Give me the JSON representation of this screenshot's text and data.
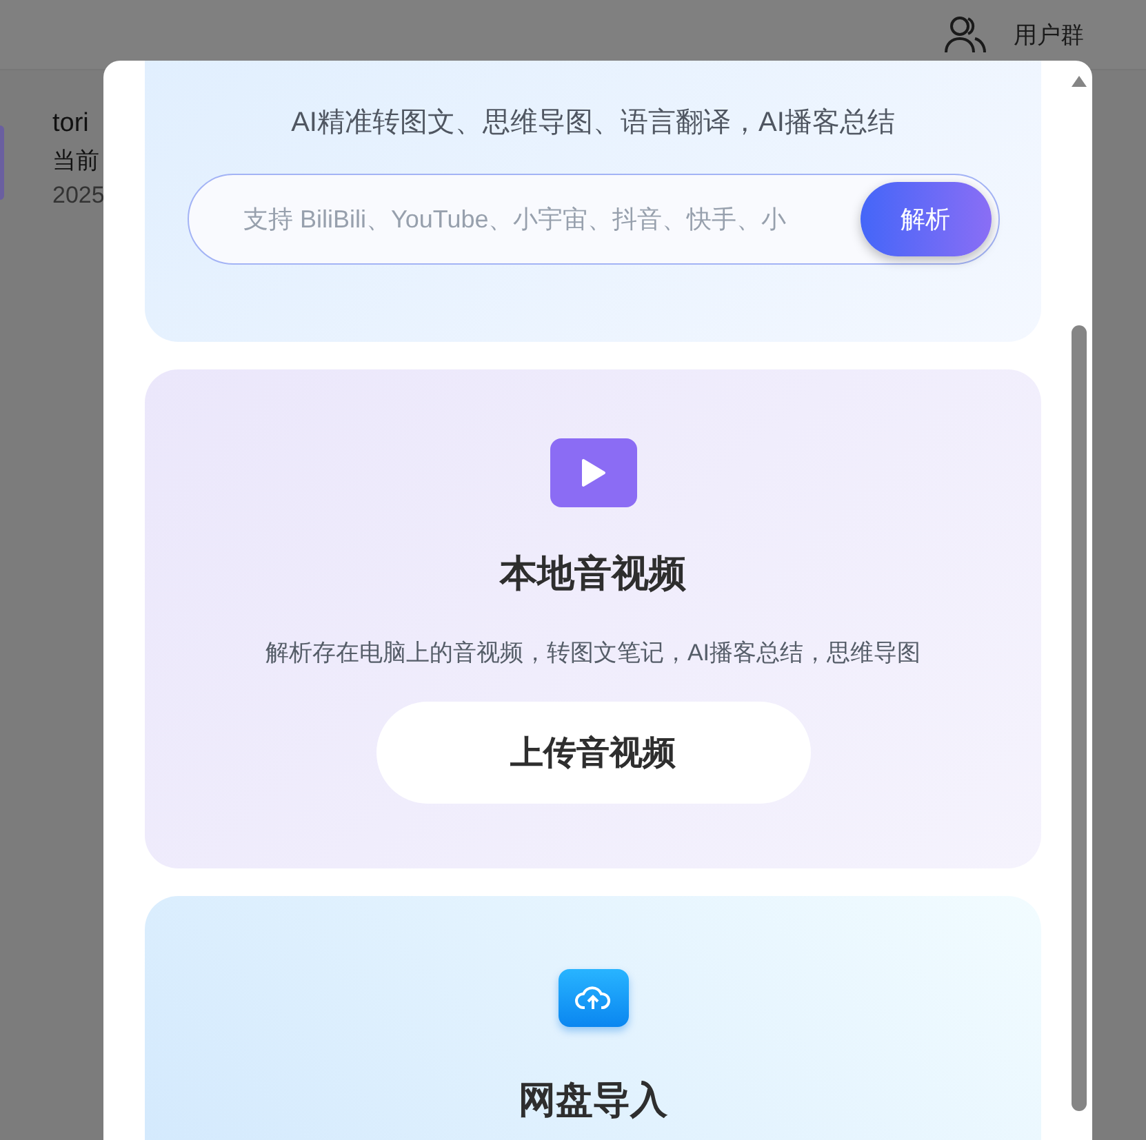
{
  "background": {
    "header": {
      "user_group_label": "用户群"
    },
    "list_item": {
      "title": "tori",
      "subtitle": "当前",
      "date": "2025"
    }
  },
  "dialog": {
    "link_card": {
      "tagline": "AI精准转图文、思维导图、语言翻译，AI播客总结",
      "url_field": {
        "placeholder": "支持 BiliBili、YouTube、小宇宙、抖音、快手、小"
      },
      "parse_button": "解析"
    },
    "cards": [
      {
        "kind": "local",
        "title": "本地音视频",
        "description": "解析存在电脑上的音视频，转图文笔记，AI播客总结，思维导图",
        "button": "上传音视频"
      },
      {
        "kind": "cloud",
        "title": "网盘导入"
      }
    ]
  }
}
